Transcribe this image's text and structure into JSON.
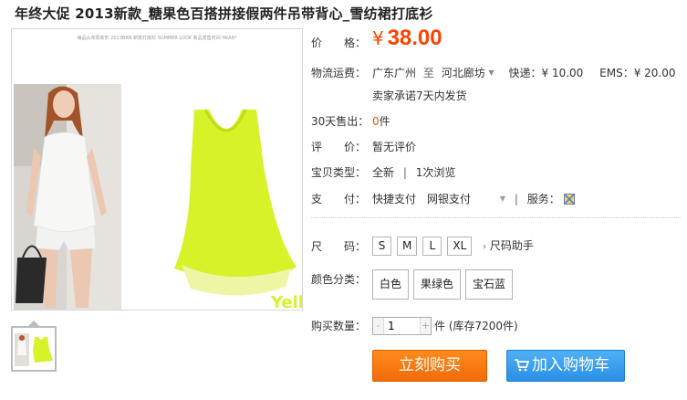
{
  "title": "年终大促 2013新款_糖果色百搭拼接假两件吊带背心_雪纺裙打底衫",
  "gallery": {
    "caption": "每品从布局新形 2013BRN 新款打底衫 SUMMER LOOK 新品发售时间 HKA6*",
    "watermark": "Yellow"
  },
  "price": {
    "label": "价　　格：",
    "currency": "¥",
    "value": "38.00"
  },
  "shipping": {
    "label": "物流运费：",
    "route_from": "广东广州",
    "route_sep": "至",
    "route_to": "河北廊坊",
    "express": "快递：¥ 10.00",
    "ems": "EMS：¥ 20.00",
    "promise": "卖家承诺7天内发货"
  },
  "sales": {
    "label": "30天售出：",
    "count": "0",
    "unit": "件"
  },
  "review": {
    "label": "评　　价：",
    "value": "暂无评价"
  },
  "item_type": {
    "label": "宝贝类型：",
    "condition": "全新",
    "sep": "|",
    "views": "1次浏览"
  },
  "payment": {
    "label": "支　　付：",
    "methods": "快捷支付　网银支付",
    "service_label": "服务："
  },
  "size": {
    "label": "尺　　码：",
    "options": [
      "S",
      "M",
      "L",
      "XL"
    ],
    "helper": "尺码助手"
  },
  "color": {
    "label": "颜色分类：",
    "options": [
      "白色",
      "果绿色",
      "宝石蓝"
    ]
  },
  "quantity": {
    "label": "购买数量：",
    "minus": "-",
    "value": "1",
    "plus": "+",
    "stock": "件 (库存7200件)"
  },
  "actions": {
    "buy_now": "立刻购买",
    "add_to_cart": "加入购物车"
  },
  "colors": {
    "price": "#ff4400",
    "buy": "#f26b0a",
    "cart": "#2a90e6",
    "shirt": "#d8f22a"
  }
}
